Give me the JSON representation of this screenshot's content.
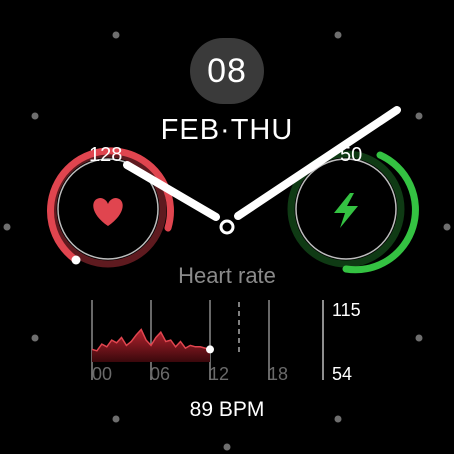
{
  "date": {
    "day": "08",
    "month_weekday": "FEB·THU"
  },
  "left_complication": {
    "value": "128",
    "icon": "heart-icon",
    "color": "#e0454f"
  },
  "right_complication": {
    "value": "50",
    "icon": "lightning-bolt-icon",
    "color": "#34c242"
  },
  "heart_rate": {
    "title": "Heart rate",
    "current": "89 BPM",
    "y_max_label": "115",
    "y_min_label": "54",
    "x_labels": [
      "00",
      "06",
      "12",
      "18"
    ]
  },
  "colors": {
    "heart_red": "#e0454f",
    "energy_green": "#34c242",
    "badge_gray": "#3a3a3a"
  },
  "chart_data": {
    "type": "area",
    "title": "Heart rate",
    "x": [
      0,
      0.5,
      1,
      1.5,
      2,
      2.5,
      3,
      3.5,
      4,
      4.5,
      5,
      5.5,
      6,
      6.5,
      7,
      7.5,
      8,
      8.5,
      9,
      9.5,
      10,
      10.5,
      11,
      11.5,
      12
    ],
    "values": [
      71,
      70,
      75,
      73,
      78,
      76,
      80,
      74,
      77,
      82,
      86,
      78,
      74,
      80,
      84,
      77,
      78,
      73,
      77,
      72,
      74,
      73,
      73,
      72,
      71
    ],
    "xlabel": "",
    "ylabel": "",
    "x_ticks": [
      "00",
      "06",
      "12",
      "18"
    ],
    "xlim": [
      0,
      24
    ],
    "ylim": [
      54,
      115
    ]
  }
}
